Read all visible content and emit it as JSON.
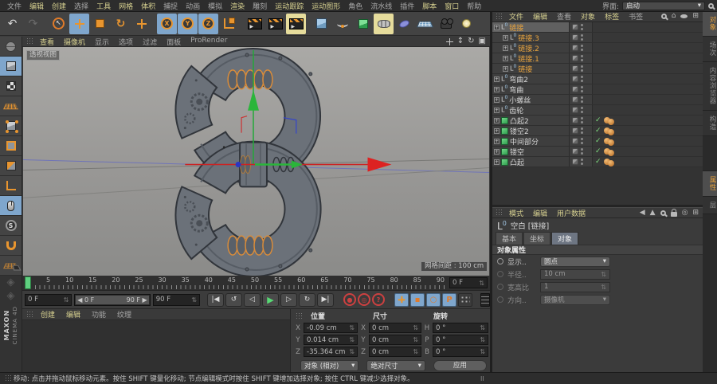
{
  "menubar": {
    "items": [
      {
        "label": "文件",
        "hl": false
      },
      {
        "label": "编辑",
        "hl": true
      },
      {
        "label": "创建",
        "hl": true
      },
      {
        "label": "选择",
        "hl": false
      },
      {
        "label": "工具",
        "hl": true
      },
      {
        "label": "网格",
        "hl": true
      },
      {
        "label": "体积",
        "hl": true
      },
      {
        "label": "捕捉",
        "hl": false
      },
      {
        "label": "动画",
        "hl": false
      },
      {
        "label": "模拟",
        "hl": false
      },
      {
        "label": "渲染",
        "hl": true
      },
      {
        "label": "雕刻",
        "hl": false
      },
      {
        "label": "运动跟踪",
        "hl": true
      },
      {
        "label": "运动图形",
        "hl": true
      },
      {
        "label": "角色",
        "hl": false
      },
      {
        "label": "流水线",
        "hl": false
      },
      {
        "label": "插件",
        "hl": false
      },
      {
        "label": "脚本",
        "hl": true
      },
      {
        "label": "窗口",
        "hl": true
      },
      {
        "label": "帮助",
        "hl": false
      }
    ],
    "interface_label": "界面:",
    "interface_value": "启动"
  },
  "toolbar": {
    "tools": [
      {
        "name": "undo-button",
        "glyph": "↶",
        "cls": "gly"
      },
      {
        "name": "redo-button",
        "glyph": "↷",
        "cls": "gly dim"
      },
      {
        "sep": true
      },
      {
        "name": "live-selection-tool",
        "icon": "ti-live-selection"
      },
      {
        "name": "move-tool",
        "icon": "cross",
        "active": true
      },
      {
        "name": "scale-tool",
        "icon": "ti-scale-tool"
      },
      {
        "name": "rotate-tool",
        "glyph": "↻",
        "cls": "gly org"
      },
      {
        "name": "last-used-tool",
        "icon": "cross"
      },
      {
        "sep": true
      },
      {
        "name": "lock-x-axis-toggle",
        "letter": "X",
        "active": true
      },
      {
        "name": "lock-y-axis-toggle",
        "letter": "Y",
        "active": true
      },
      {
        "name": "lock-z-axis-toggle",
        "letter": "Z",
        "active": true
      },
      {
        "name": "coordinate-system-toggle",
        "icon": "ti-coord-system"
      },
      {
        "sep": true
      },
      {
        "name": "render-view-button",
        "icon": "clap"
      },
      {
        "name": "render-to-picture-button",
        "icon": "clap"
      },
      {
        "name": "render-settings-button",
        "icon": "clap",
        "activey": true
      },
      {
        "sep": true
      },
      {
        "name": "add-cube-button",
        "icon": "ti-add-cube"
      },
      {
        "name": "add-spline-button",
        "icon": "ti-add-spline"
      },
      {
        "name": "add-subdivision-button",
        "icon": "ti-add-subdivision"
      },
      {
        "name": "add-sweep-button",
        "icon": "ti-add-sweep",
        "activey": true
      },
      {
        "name": "add-spline-primitive-button",
        "icon": "ti-add-spline-primitive"
      },
      {
        "name": "add-floor-button",
        "icon": "ti-add-floor"
      },
      {
        "name": "add-camera-button",
        "icon": "ti-add-camera"
      },
      {
        "name": "add-light-button",
        "icon": "ti-add-light"
      }
    ]
  },
  "sidebar": {
    "tools": [
      {
        "name": "display-globe-icon",
        "icon": "t-globe"
      },
      {
        "name": "model-mode-button",
        "icon": "cubeic",
        "active": true
      },
      {
        "name": "texture-mode-button",
        "icon": "t-texture-mode"
      },
      {
        "name": "workplane-mode-button",
        "icon": "t-workplane"
      },
      {
        "name": "points-mode-button",
        "icon": "cubeic t-points-mode"
      },
      {
        "name": "edges-mode-button",
        "icon": "t-edges-mode"
      },
      {
        "name": "polygons-mode-button",
        "icon": "t-polygons-mode"
      },
      {
        "name": "enable-axis-button",
        "icon": "t-axis-mode"
      },
      {
        "name": "viewport-nav-button",
        "icon": "t-viewport-nav",
        "active": true
      },
      {
        "name": "snap-settings-button",
        "icon": "t-snap"
      },
      {
        "name": "magnet-tool-button",
        "icon": "t-magnet"
      },
      {
        "name": "workplane-lock-button",
        "icon": "t-workplane t-workplane-lock"
      }
    ]
  },
  "viewport": {
    "menu": [
      {
        "label": "查看",
        "hl": true
      },
      {
        "label": "摄像机",
        "hl": true
      },
      {
        "label": "显示",
        "hl": false
      },
      {
        "label": "选项",
        "hl": false
      },
      {
        "label": "过滤",
        "hl": false
      },
      {
        "label": "面板",
        "hl": false
      },
      {
        "label": "ProRender",
        "hl": false
      }
    ],
    "view_label": "透视视图",
    "grid_label": "网格间距 : 100 cm"
  },
  "timeline": {
    "ticks": [
      "0",
      "5",
      "10",
      "15",
      "20",
      "25",
      "30",
      "35",
      "40",
      "45",
      "50",
      "55",
      "60",
      "65",
      "70",
      "75",
      "80",
      "85",
      "90"
    ],
    "frame_box": "0 F"
  },
  "transport": {
    "current": "0 F",
    "range_start": "0 F",
    "range_end": "90 F",
    "end": "90 F",
    "buttons": [
      {
        "name": "goto-start-button",
        "glyph": "|◀",
        "kind": "btn"
      },
      {
        "name": "play-reverse-button",
        "glyph": "↺",
        "kind": "btn"
      },
      {
        "name": "previous-frame-button",
        "glyph": "◁",
        "kind": "btn"
      },
      {
        "name": "play-forward-button",
        "glyph": "▶",
        "kind": "play"
      },
      {
        "name": "next-frame-button",
        "glyph": "▷",
        "kind": "btn"
      },
      {
        "name": "play-loop-button",
        "glyph": "↻",
        "kind": "btn"
      },
      {
        "name": "goto-end-button",
        "glyph": "▶|",
        "kind": "btn"
      },
      {
        "sep": true
      },
      {
        "name": "record-keyframe-button",
        "glyph": "●",
        "kind": "red"
      },
      {
        "name": "autokey-button",
        "glyph": "◎",
        "kind": "red"
      },
      {
        "name": "key-help-button",
        "glyph": "?",
        "kind": "red"
      },
      {
        "sep": true
      },
      {
        "name": "key-position-toggle",
        "glyph": "+",
        "kind": "keycross"
      },
      {
        "name": "key-scale-toggle",
        "glyph": "▪",
        "kind": "key"
      },
      {
        "name": "key-rotation-toggle",
        "glyph": "○",
        "kind": "key"
      },
      {
        "name": "key-parameter-toggle",
        "glyph": "P",
        "kind": "key"
      },
      {
        "name": "key-pla-toggle",
        "glyph": "",
        "kind": "dots"
      },
      {
        "name": "timeline-layout-button",
        "glyph": "",
        "kind": "film"
      }
    ]
  },
  "materials": {
    "menu": [
      {
        "label": "创建",
        "hl": true
      },
      {
        "label": "编辑",
        "hl": true
      },
      {
        "label": "功能",
        "hl": false
      },
      {
        "label": "纹理",
        "hl": false
      }
    ]
  },
  "coords": {
    "headers": [
      "位置",
      "尺寸",
      "旋转"
    ],
    "axis_labels": [
      "X",
      "Y",
      "Z"
    ],
    "rot_labels": [
      "H",
      "P",
      "B"
    ],
    "px": "-0.09 cm",
    "py": "0.014 cm",
    "pz": "-35.364 cm",
    "sx": "0 cm",
    "sy": "0 cm",
    "sz": "0 cm",
    "rh": "0 °",
    "rp": "0 °",
    "rb": "0 °",
    "mode_object": "对象 (相对)",
    "mode_size": "绝对尺寸",
    "apply": "应用"
  },
  "object_manager": {
    "menu": [
      {
        "label": "文件",
        "hl": true
      },
      {
        "label": "编辑",
        "hl": true
      },
      {
        "label": "查看",
        "hl": false
      },
      {
        "label": "对象",
        "hl": true
      },
      {
        "label": "标签",
        "hl": true
      },
      {
        "label": "书签",
        "hl": false
      }
    ],
    "objects": [
      {
        "name": "链接",
        "depth": 0,
        "icon": "null",
        "selected": true,
        "rowsel": true
      },
      {
        "name": "链接.3",
        "depth": 1,
        "icon": "null",
        "selected": true
      },
      {
        "name": "链接.2",
        "depth": 1,
        "icon": "null",
        "selected": true
      },
      {
        "name": "链接.1",
        "depth": 1,
        "icon": "null",
        "selected": true
      },
      {
        "name": "链接",
        "depth": 1,
        "icon": "null",
        "selected": true
      },
      {
        "name": "弯曲2",
        "depth": 0,
        "icon": "null"
      },
      {
        "name": "弯曲",
        "depth": 0,
        "icon": "null"
      },
      {
        "name": "小螺丝",
        "depth": 0,
        "icon": "null"
      },
      {
        "name": "齿轮",
        "depth": 0,
        "icon": "null"
      },
      {
        "name": "凸起2",
        "depth": 0,
        "icon": "poly",
        "check": true,
        "tags": true
      },
      {
        "name": "镂空2",
        "depth": 0,
        "icon": "poly",
        "check": true,
        "tags": true
      },
      {
        "name": "中间部分",
        "depth": 0,
        "icon": "poly",
        "check": true,
        "tags": true
      },
      {
        "name": "镂空",
        "depth": 0,
        "icon": "poly",
        "check": true,
        "tags": true
      },
      {
        "name": "凸起",
        "depth": 0,
        "icon": "poly",
        "check": true,
        "tags": true
      }
    ]
  },
  "attributes": {
    "menu": [
      {
        "label": "模式",
        "hl": true
      },
      {
        "label": "编辑",
        "hl": true
      },
      {
        "label": "用户数据",
        "hl": true
      }
    ],
    "title": "空白 [链接]",
    "tabs": [
      {
        "label": "基本",
        "active": false
      },
      {
        "label": "坐标",
        "active": false
      },
      {
        "label": "对象",
        "active": true
      }
    ],
    "section": "对象属性",
    "rows": {
      "display_label": "显示..",
      "display_value": "圆点",
      "radius_label": "半径..",
      "radius_value": "10 cm",
      "aspect_label": "宽高比",
      "aspect_value": "1",
      "orient_label": "方向..",
      "orient_value": "摄像机"
    }
  },
  "right_tabs": {
    "top": [
      {
        "label": "对象",
        "active": true
      },
      {
        "label": "场次",
        "active": false
      },
      {
        "label": "内容浏览器",
        "active": false
      },
      {
        "label": "构造",
        "active": false
      }
    ],
    "bottom": [
      {
        "label": "属性",
        "active": true
      },
      {
        "label": "层",
        "active": false
      }
    ]
  },
  "statusbar": {
    "text": "移动: 点击并拖动鼠标移动元素。按住 SHIFT 键量化移动; 节点编辑模式时按住 SHIFT 键增加选择对象; 按住 CTRL 键减少选择对象。"
  },
  "branding": {
    "maxon": "MAXON",
    "cinema": "CINEMA 4D"
  }
}
